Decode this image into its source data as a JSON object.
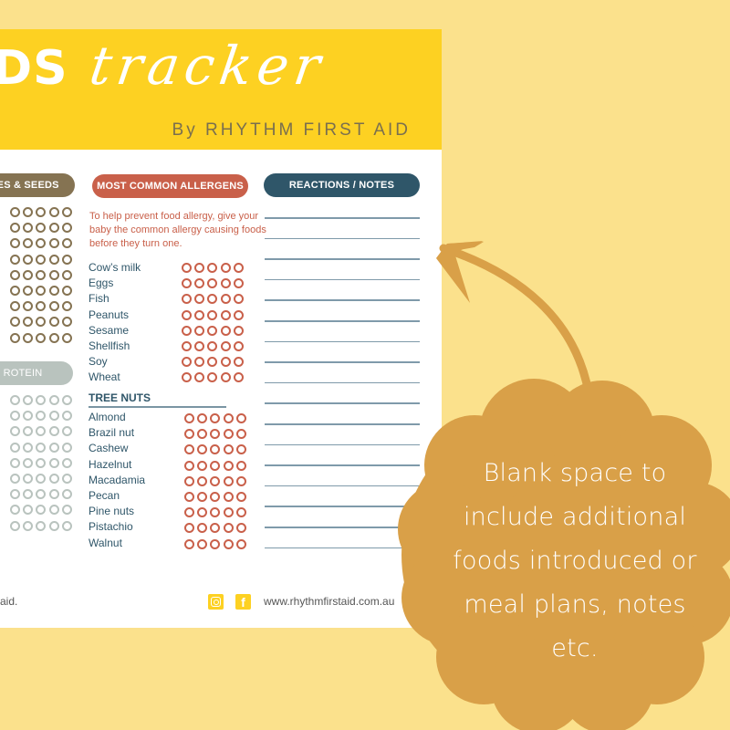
{
  "header": {
    "title_bold": "DS",
    "title_script": "tracker",
    "byline": "By RHYTHM FIRST AID"
  },
  "sections": {
    "legumes_seeds": {
      "label": "MES & SEEDS",
      "rows": 9
    },
    "protein": {
      "label": "ROTEIN",
      "rows": 9
    },
    "allergens": {
      "label": "MOST COMMON ALLERGENS",
      "intro": "To help prevent food allergy, give your baby the common allergy causing foods before they turn one.",
      "items": [
        "Cow’s milk",
        "Eggs",
        "Fish",
        "Peanuts",
        "Sesame",
        "Shellfish",
        "Soy",
        "Wheat"
      ]
    },
    "tree_nuts": {
      "label": "TREE NUTS",
      "items": [
        "Almond",
        "Brazil nut",
        "Cashew",
        "Hazelnut",
        "Macadamia",
        "Pecan",
        "Pine nuts",
        "Pistachio",
        "Walnut"
      ]
    },
    "notes": {
      "label": "REACTIONS / NOTES",
      "line_count": 17
    }
  },
  "tracking": {
    "circles_per_row": 5
  },
  "footer": {
    "left_text": "aid.",
    "instagram_icon": "instagram-icon",
    "facebook_icon": "facebook-icon",
    "facebook_glyph": "f",
    "url": "www.rhythmfirstaid.com.au"
  },
  "callout": {
    "text": "Blank space to include additional foods introduced or meal plans, notes etc.",
    "lines": [
      "Blank space to",
      "include additional",
      "foods introduced or",
      "meal plans, notes",
      "etc."
    ]
  },
  "colors": {
    "background": "#fbe18c",
    "header_yellow": "#fdd122",
    "legumes_brown": "#857352",
    "protein_gray": "#b9c3be",
    "allergen_red": "#c9604a",
    "notes_blue": "#2f5669",
    "callout_orange": "#d9a048"
  }
}
